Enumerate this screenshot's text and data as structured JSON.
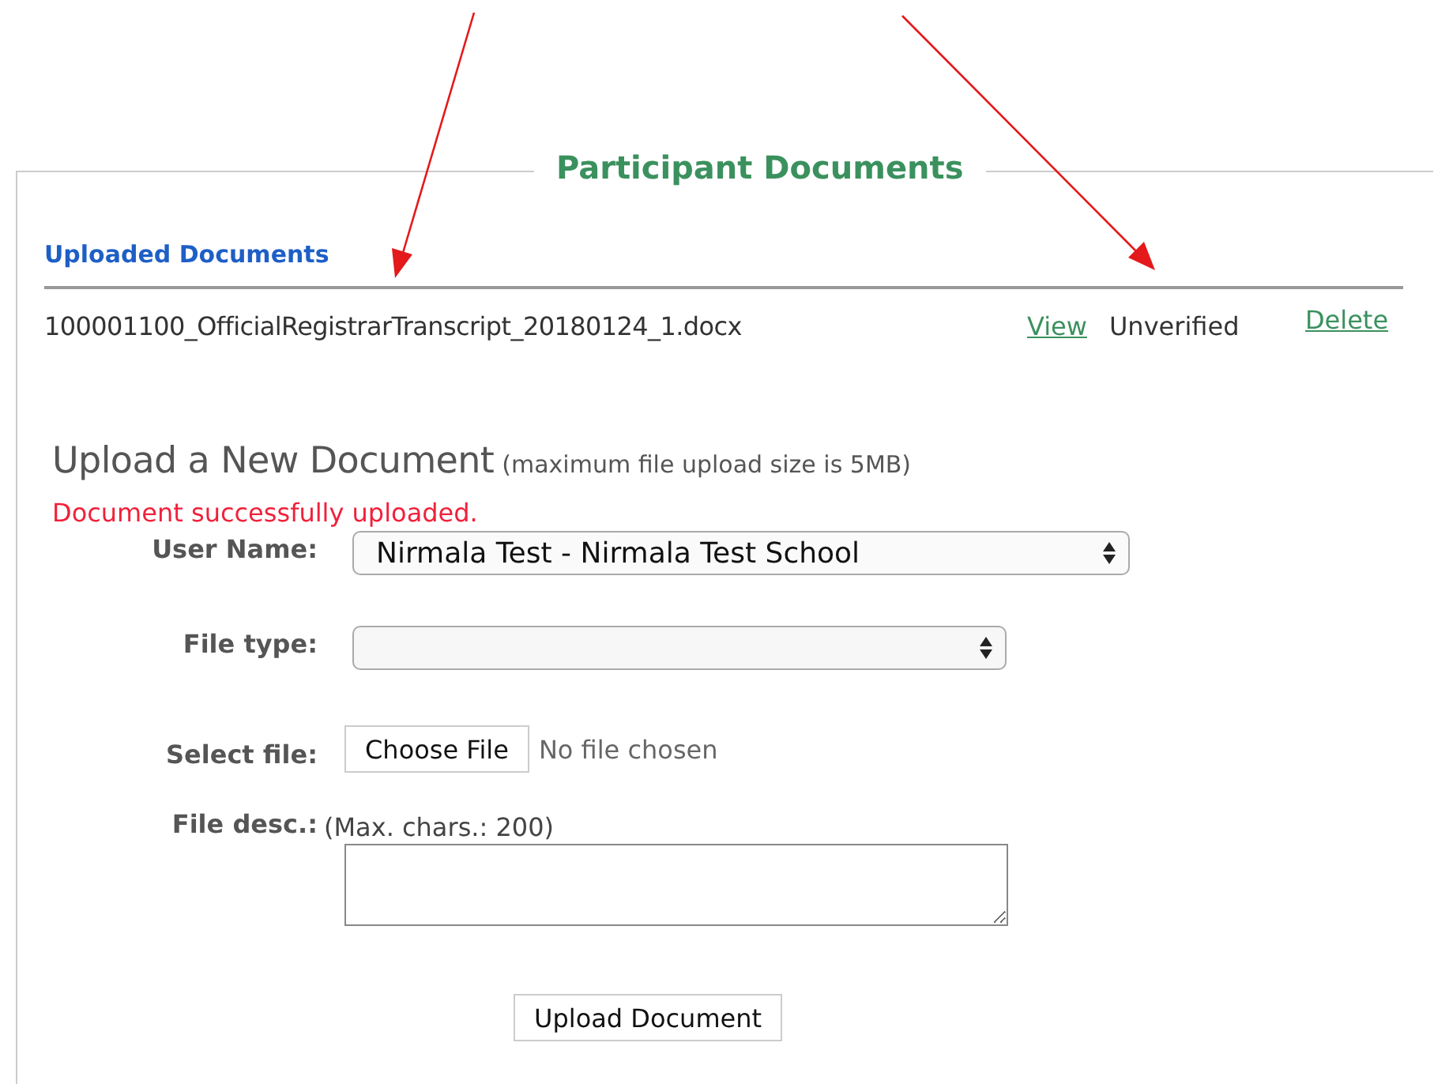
{
  "panel": {
    "title": "Participant Documents"
  },
  "uploaded": {
    "heading": "Uploaded Documents",
    "documents": [
      {
        "file_name": "100001100_OfficialRegistrarTranscript_20180124_1.docx",
        "view_link": "View",
        "status": "Unverified",
        "delete_link": "Delete"
      }
    ]
  },
  "upload_form": {
    "heading": "Upload a New Document",
    "size_note": "(maximum file upload size is 5MB)",
    "message": "Document successfully uploaded.",
    "fields": [
      {
        "kind": "select",
        "label": "User Name:",
        "value": "Nirmala Test - Nirmala Test School"
      },
      {
        "kind": "select",
        "label": "File type:"
      },
      {
        "kind": "file",
        "label": "Select file:",
        "button": "Choose File",
        "status": "No file chosen"
      },
      {
        "kind": "textarea",
        "label": "File desc.:",
        "hint": "(Max. chars.: 200)"
      }
    ],
    "submit": "Upload Document"
  }
}
